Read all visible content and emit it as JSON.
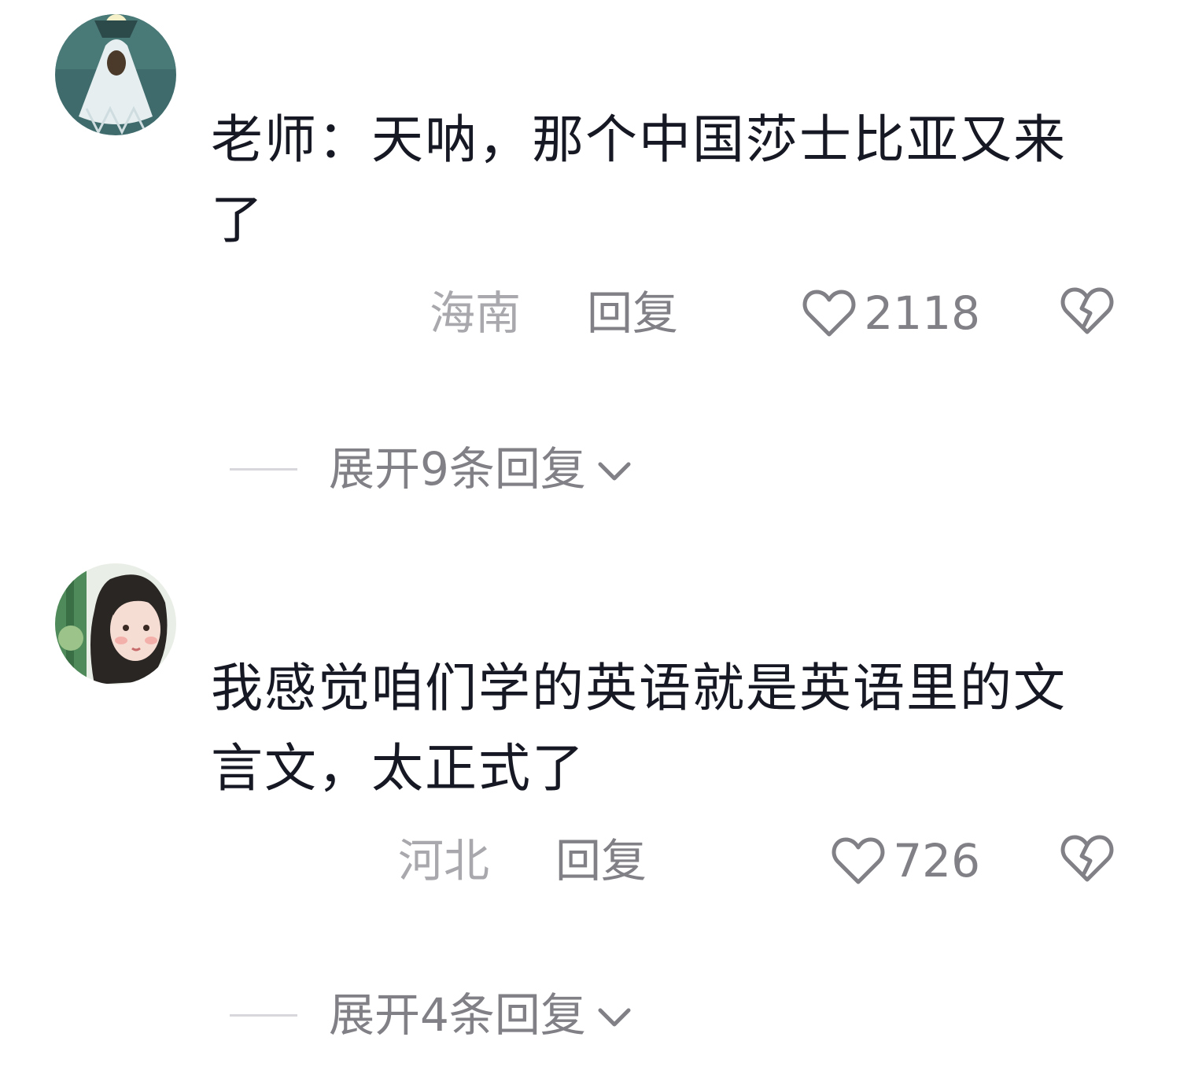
{
  "comments": [
    {
      "avatar_icon": "user-avatar-icon",
      "text": "老师：天呐，那个中国莎士比亚又来了",
      "location": "海南",
      "reply_label": "回复",
      "like_count": "2118",
      "expand_label": "展开9条回复"
    },
    {
      "avatar_icon": "user-avatar-icon",
      "text": "我感觉咱们学的英语就是英语里的文言文，太正式了",
      "location": "河北",
      "reply_label": "回复",
      "like_count": "726",
      "expand_label": "展开4条回复"
    }
  ],
  "icons": {
    "like": "heart-outline-icon",
    "dislike": "broken-heart-icon",
    "expand": "chevron-down-icon"
  },
  "colors": {
    "text_primary": "#161823",
    "text_secondary": "#808086",
    "text_muted": "#a8a8ad"
  }
}
